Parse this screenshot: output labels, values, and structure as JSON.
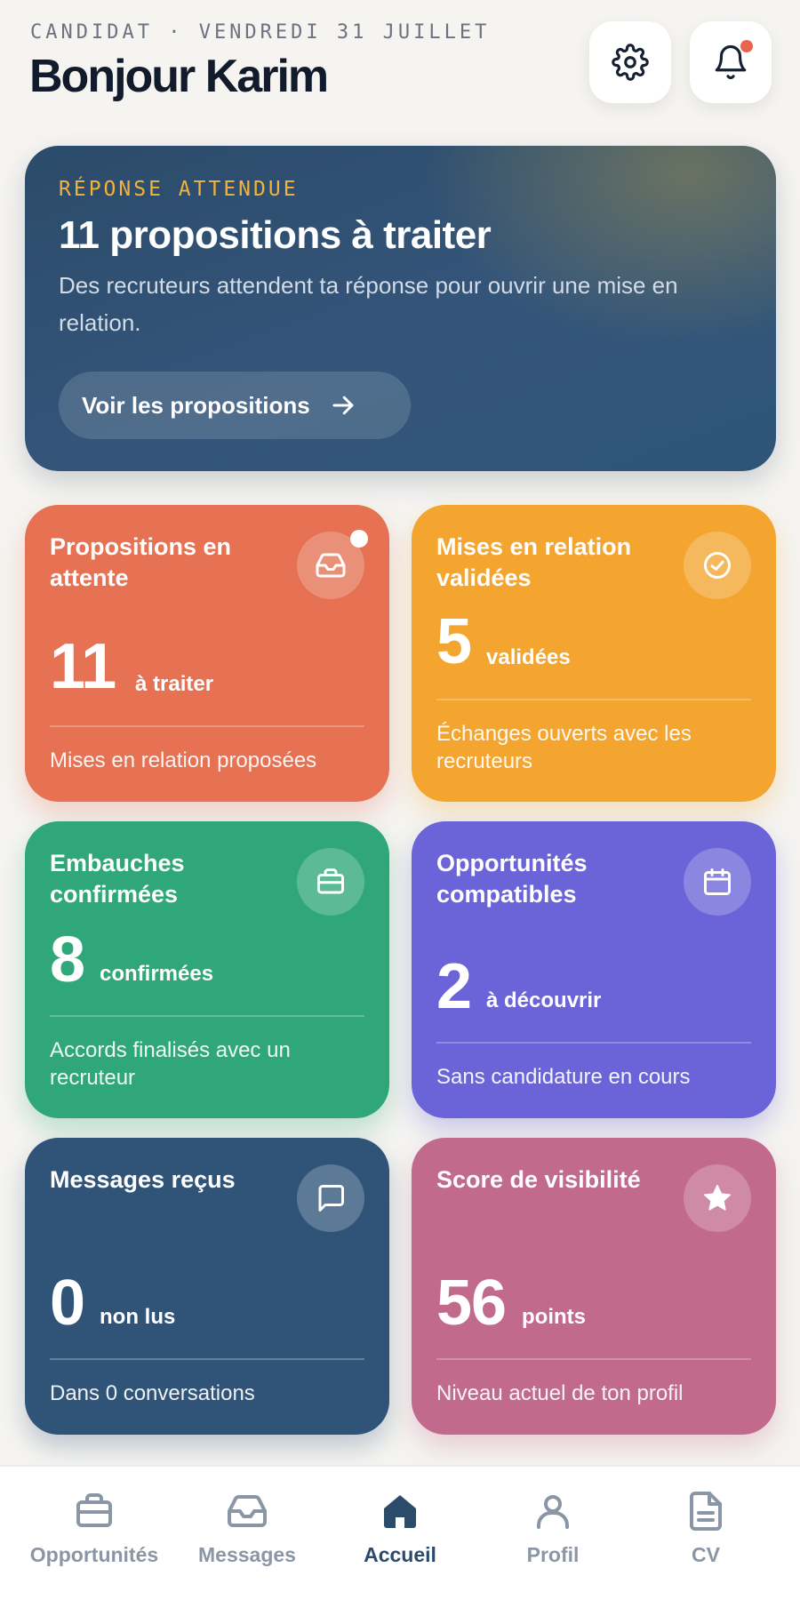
{
  "header": {
    "eyebrow": "CANDIDAT · VENDREDI 31 JUILLET",
    "greeting": "Bonjour Karim",
    "settings_icon": "gear-icon",
    "notifications_icon": "bell-icon",
    "notification_dot_color": "#e8654b"
  },
  "hero": {
    "eyebrow": "RÉPONSE ATTENDUE",
    "title": "11 propositions à traiter",
    "description": "Des recruteurs attendent ta réponse pour ouvrir une mise en relation.",
    "cta_label": "Voir les propositions",
    "cta_icon": "arrow-right-icon"
  },
  "cards": [
    {
      "title": "Propositions en attente",
      "value": "11",
      "unit": "à traiter",
      "footer": "Mises en relation proposées",
      "icon": "inbox-icon",
      "color": "#e67153"
    },
    {
      "title": "Mises en relation validées",
      "value": "5",
      "unit": "validées",
      "footer": "Échanges ouverts avec les recruteurs",
      "icon": "check-circle-icon",
      "color": "#f3a530"
    },
    {
      "title": "Embauches confirmées",
      "value": "8",
      "unit": "confirmées",
      "footer": "Accords finalisés avec un recruteur",
      "icon": "briefcase-icon",
      "color": "#2fa77a"
    },
    {
      "title": "Opportunités compatibles",
      "value": "2",
      "unit": "à découvrir",
      "footer": "Sans candidature en cours",
      "icon": "calendar-icon",
      "color": "#6b64d8"
    },
    {
      "title": "Messages reçus",
      "value": "0",
      "unit": "non lus",
      "footer": "Dans 0 conversations",
      "icon": "chat-icon",
      "color": "#2f5478"
    },
    {
      "title": "Score de visibilité",
      "value": "56",
      "unit": "points",
      "footer": "Niveau actuel de ton profil",
      "icon": "star-icon",
      "color": "#c26a8c"
    }
  ],
  "nav": {
    "items": [
      {
        "label": "Opportunités",
        "icon": "briefcase-icon"
      },
      {
        "label": "Messages",
        "icon": "inbox-icon"
      },
      {
        "label": "Accueil",
        "icon": "home-icon",
        "active": true
      },
      {
        "label": "Profil",
        "icon": "user-icon"
      },
      {
        "label": "CV",
        "icon": "document-icon"
      }
    ]
  }
}
